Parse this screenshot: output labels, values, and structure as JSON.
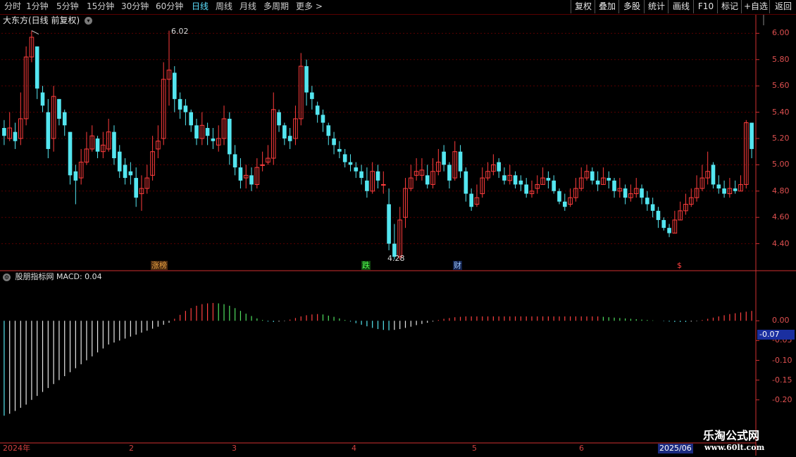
{
  "toolbar": {
    "periods": [
      {
        "label": "分时"
      },
      {
        "label": "1分钟"
      },
      {
        "label": "5分钟"
      },
      {
        "label": "15分钟"
      },
      {
        "label": "30分钟"
      },
      {
        "label": "60分钟"
      },
      {
        "label": "日线",
        "active": true
      },
      {
        "label": "周线"
      },
      {
        "label": "月线"
      },
      {
        "label": "多周期"
      },
      {
        "label": "更多 >"
      }
    ],
    "tools": [
      {
        "label": "复权"
      },
      {
        "label": "叠加"
      },
      {
        "label": "多股"
      },
      {
        "label": "统计"
      },
      {
        "label": "画线"
      },
      {
        "label": "F10"
      },
      {
        "label": "标记"
      },
      {
        "label": "+自选"
      },
      {
        "label": "返回"
      }
    ]
  },
  "chart_title": "大东方(日线 前复权)",
  "chart_title_icon": "chevron-down-icon",
  "indicator_title": "股朋指标网  MACD: 0.04",
  "current_value": "-0.07",
  "high_label": "6.02",
  "low_label": "4.28",
  "events": [
    {
      "label": "涨榜",
      "color": "#e8a040",
      "bg": "#4a2a10"
    },
    {
      "label": "跌",
      "color": "#50ff50",
      "bg": "#104a10"
    },
    {
      "label": "财",
      "color": "#a0c8ff",
      "bg": "#10204a"
    },
    {
      "label": "$",
      "color": "#ff4040",
      "bg": "#000000"
    }
  ],
  "dates": [
    {
      "label": "2024年"
    },
    {
      "label": "2"
    },
    {
      "label": "3"
    },
    {
      "label": "4"
    },
    {
      "label": "5"
    },
    {
      "label": "6"
    },
    {
      "label": "2025/06",
      "boxed": true
    }
  ],
  "watermark": {
    "title": "乐淘公式网",
    "url": "www.60lt.com"
  },
  "colors": {
    "up": "#ff3c3c",
    "down": "#54e6f0",
    "grid": "#5a0000",
    "axis": "#d03030"
  },
  "chart_data": [
    {
      "type": "candlestick",
      "ylim": [
        4.2,
        6.05
      ],
      "yticks": [
        6.0,
        5.8,
        5.6,
        5.4,
        5.2,
        5.0,
        4.8,
        4.6,
        4.4
      ],
      "high": {
        "value": 6.02
      },
      "low": [
        5.15,
        5.18,
        5.12,
        5.15,
        5.3,
        5.78,
        5.5,
        5.4,
        5.05,
        5.1,
        5.3,
        5.22,
        4.85,
        4.7,
        4.85,
        5.0,
        5.1,
        5.05,
        5.05,
        5.1,
        5.0,
        4.9,
        4.85,
        4.85,
        4.68,
        4.65,
        4.78,
        4.88,
        5.05,
        5.15,
        5.45,
        5.4,
        5.35,
        5.3,
        5.25,
        5.15,
        5.15,
        5.15,
        5.12,
        5.1,
        5.15,
        5.0,
        4.92,
        4.82,
        4.82,
        4.8,
        4.82,
        4.95,
        5.0,
        5.0,
        5.25,
        5.15,
        5.12,
        5.15,
        5.3,
        5.45,
        5.42,
        5.32,
        5.25,
        5.15,
        5.08,
        5.05,
        4.98,
        4.95,
        4.9,
        4.85,
        4.75,
        4.78,
        4.82,
        4.78,
        4.35,
        4.28,
        4.28,
        4.52,
        4.8,
        4.88,
        4.88,
        4.82,
        4.82,
        4.92,
        4.95,
        4.82,
        4.88,
        4.9,
        4.72,
        4.65,
        4.68,
        4.75,
        4.88,
        4.92,
        4.9,
        4.85,
        4.85,
        4.82,
        4.8,
        4.75,
        4.75,
        4.78,
        4.85,
        4.82,
        4.78,
        4.7,
        4.65,
        4.68,
        4.72,
        4.8,
        4.88,
        4.85,
        4.8,
        4.85,
        4.82,
        4.75,
        4.75,
        4.7,
        4.72,
        4.75,
        4.7,
        4.65,
        4.6,
        4.52,
        4.5,
        4.45,
        4.48,
        4.58,
        4.62,
        4.68,
        4.72,
        4.8,
        4.85,
        4.82,
        4.78,
        4.75,
        4.75,
        4.78,
        4.8,
        4.82,
        5.05
      ],
      "close": [
        5.22,
        5.28,
        5.18,
        5.35,
        5.82,
        5.97,
        5.58,
        5.45,
        5.12,
        5.52,
        5.35,
        5.3,
        4.92,
        4.88,
        5.02,
        5.12,
        5.22,
        5.1,
        5.15,
        5.25,
        5.05,
        4.95,
        4.9,
        4.92,
        4.75,
        4.82,
        4.9,
        5.1,
        5.18,
        5.65,
        5.72,
        5.5,
        5.42,
        5.4,
        5.3,
        5.2,
        5.3,
        5.22,
        5.18,
        5.2,
        5.35,
        5.08,
        4.98,
        4.88,
        4.92,
        4.85,
        4.98,
        5.0,
        5.05,
        5.42,
        5.3,
        5.2,
        5.18,
        5.35,
        5.75,
        5.55,
        5.5,
        5.38,
        5.32,
        5.22,
        5.15,
        5.1,
        5.02,
        5.0,
        4.95,
        4.9,
        4.8,
        4.95,
        4.88,
        4.85,
        4.4,
        4.3,
        4.58,
        4.82,
        4.9,
        4.95,
        4.96,
        4.85,
        4.95,
        5.02,
        5.0,
        4.88,
        5.1,
        4.95,
        4.78,
        4.68,
        4.75,
        4.9,
        4.95,
        5.0,
        4.95,
        4.88,
        4.92,
        4.85,
        4.85,
        4.78,
        4.8,
        4.85,
        4.9,
        4.88,
        4.8,
        4.72,
        4.68,
        4.75,
        4.82,
        4.9,
        4.95,
        4.88,
        4.85,
        4.9,
        4.88,
        4.8,
        4.82,
        4.75,
        4.78,
        4.82,
        4.75,
        4.7,
        4.65,
        4.58,
        4.52,
        4.48,
        4.58,
        4.65,
        4.7,
        4.75,
        4.82,
        4.9,
        4.95,
        4.85,
        4.82,
        4.78,
        4.82,
        4.8,
        4.85,
        5.32,
        5.12
      ],
      "open": [
        5.28,
        5.2,
        5.25,
        5.2,
        5.35,
        5.82,
        5.9,
        5.55,
        5.4,
        5.2,
        5.5,
        5.4,
        5.25,
        4.95,
        4.9,
        5.02,
        5.12,
        5.2,
        5.1,
        5.12,
        5.25,
        5.1,
        5.0,
        4.95,
        4.9,
        4.78,
        4.82,
        4.92,
        5.12,
        5.2,
        5.65,
        5.7,
        5.5,
        5.45,
        5.4,
        5.3,
        5.2,
        5.28,
        5.2,
        5.15,
        5.2,
        5.35,
        5.08,
        4.98,
        4.9,
        4.92,
        4.85,
        5.0,
        5.02,
        5.05,
        5.4,
        5.3,
        5.22,
        5.2,
        5.35,
        5.75,
        5.55,
        5.45,
        5.38,
        5.3,
        5.2,
        5.12,
        5.08,
        5.02,
        4.98,
        4.95,
        4.88,
        4.8,
        4.95,
        4.85,
        4.7,
        4.4,
        4.3,
        4.6,
        4.82,
        4.92,
        4.92,
        4.92,
        4.85,
        4.95,
        5.1,
        5.0,
        4.9,
        5.1,
        4.95,
        4.78,
        4.7,
        4.78,
        4.9,
        4.95,
        5.02,
        4.92,
        4.88,
        4.92,
        4.88,
        4.85,
        4.78,
        4.82,
        4.85,
        4.9,
        4.88,
        4.8,
        4.72,
        4.7,
        4.75,
        4.82,
        4.9,
        4.95,
        4.88,
        4.85,
        4.9,
        4.88,
        4.8,
        4.82,
        4.75,
        4.78,
        4.82,
        4.75,
        4.7,
        4.65,
        4.58,
        4.52,
        4.48,
        4.58,
        4.65,
        4.7,
        4.75,
        4.82,
        4.9,
        5.0,
        4.85,
        4.82,
        4.78,
        4.82,
        4.8,
        4.85,
        5.32
      ],
      "up_high": [
        5.34,
        5.4,
        5.32,
        5.55,
        5.9,
        6.02,
        5.7,
        5.6,
        5.5,
        5.6,
        5.5,
        5.42,
        5.1,
        5.0,
        5.12,
        5.25,
        5.3,
        5.22,
        5.25,
        5.35,
        5.3,
        5.15,
        5.05,
        5.02,
        4.98,
        4.92,
        5.0,
        5.22,
        5.3,
        5.78,
        6.02,
        5.75,
        5.55,
        5.5,
        5.42,
        5.35,
        5.4,
        5.32,
        5.28,
        5.3,
        5.45,
        5.4,
        5.15,
        5.05,
        5.0,
        4.98,
        5.05,
        5.1,
        5.15,
        5.55,
        5.42,
        5.32,
        5.28,
        5.45,
        5.85,
        5.8,
        5.6,
        5.48,
        5.42,
        5.32,
        5.25,
        5.18,
        5.12,
        5.08,
        5.02,
        5.0,
        4.98,
        5.02,
        5.0,
        4.95,
        4.82,
        4.55,
        4.68,
        4.9,
        5.0,
        5.05,
        5.05,
        5.0,
        5.05,
        5.12,
        5.15,
        5.02,
        5.18,
        5.15,
        4.98,
        4.82,
        4.85,
        4.98,
        5.02,
        5.08,
        5.05,
        4.98,
        5.0,
        4.95,
        4.92,
        4.9,
        4.88,
        4.92,
        4.98,
        4.95,
        4.92,
        4.82,
        4.78,
        4.82,
        4.9,
        4.98,
        5.0,
        4.98,
        4.95,
        4.98,
        4.95,
        4.9,
        4.9,
        4.85,
        4.85,
        4.9,
        4.85,
        4.8,
        4.75,
        4.68,
        4.6,
        4.55,
        4.65,
        4.72,
        4.78,
        4.82,
        4.92,
        5.0,
        5.1,
        5.02,
        4.92,
        4.88,
        4.9,
        4.88,
        4.92,
        5.34,
        5.18
      ]
    },
    {
      "type": "bar",
      "title": "MACD",
      "ylim": [
        -0.3,
        0.1
      ],
      "yticks": [
        -0.0,
        -0.05,
        -0.1,
        -0.15,
        -0.2
      ],
      "values": [
        -0.24,
        -0.235,
        -0.228,
        -0.22,
        -0.212,
        -0.2,
        -0.19,
        -0.18,
        -0.17,
        -0.16,
        -0.15,
        -0.14,
        -0.13,
        -0.12,
        -0.11,
        -0.1,
        -0.09,
        -0.08,
        -0.07,
        -0.06,
        -0.055,
        -0.05,
        -0.045,
        -0.04,
        -0.035,
        -0.03,
        -0.025,
        -0.02,
        -0.015,
        -0.01,
        -0.005,
        0.005,
        0.015,
        0.025,
        0.032,
        0.038,
        0.042,
        0.044,
        0.045,
        0.044,
        0.042,
        0.038,
        0.032,
        0.025,
        0.018,
        0.012,
        0.006,
        0.002,
        -0.002,
        -0.003,
        -0.002,
        -0.001,
        0.003,
        0.007,
        0.011,
        0.014,
        0.016,
        0.017,
        0.016,
        0.013,
        0.01,
        0.006,
        0.002,
        -0.002,
        -0.006,
        -0.01,
        -0.014,
        -0.018,
        -0.021,
        -0.023,
        -0.024,
        -0.023,
        -0.021,
        -0.018,
        -0.015,
        -0.011,
        -0.008,
        -0.005,
        -0.002,
        0.002,
        0.005,
        0.007,
        0.009,
        0.01,
        0.011,
        0.011,
        0.011,
        0.011,
        0.011,
        0.011,
        0.011,
        0.011,
        0.011,
        0.011,
        0.011,
        0.011,
        0.011,
        0.011,
        0.011,
        0.011,
        0.011,
        0.011,
        0.011,
        0.011,
        0.011,
        0.011,
        0.011,
        0.011,
        0.011,
        0.01,
        0.009,
        0.008,
        0.007,
        0.006,
        0.005,
        0.004,
        0.003,
        0.002,
        0.001,
        0,
        -0.001,
        -0.002,
        -0.003,
        -0.003,
        -0.003,
        -0.002,
        -0.001,
        0.002,
        0.005,
        0.008,
        0.011,
        0.014,
        0.017,
        0.019,
        0.021,
        0.023,
        0.025
      ]
    }
  ]
}
